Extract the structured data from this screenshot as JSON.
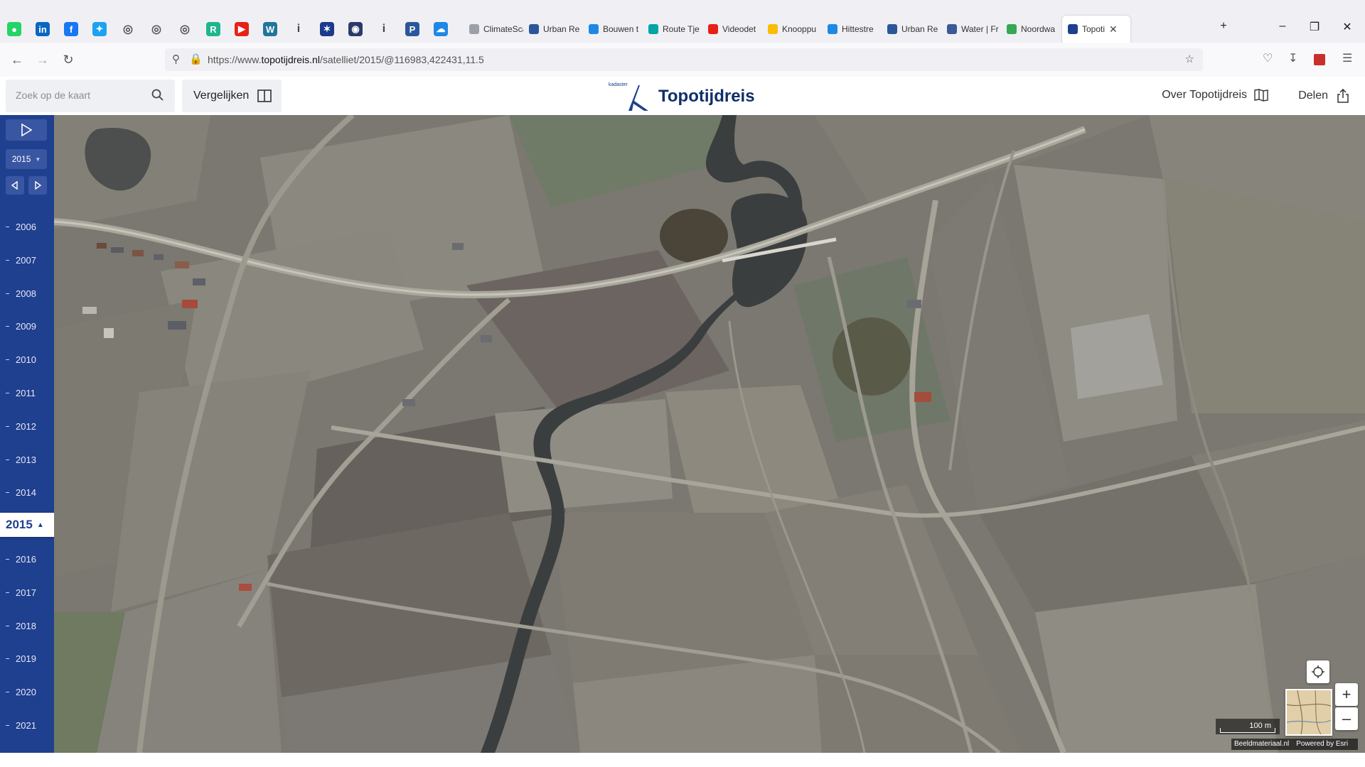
{
  "browser": {
    "pinned_icons": [
      "whatsapp-icon",
      "linkedin-icon",
      "facebook-icon",
      "twitter-icon",
      "globe-icon",
      "globe-icon",
      "globe-icon",
      "rg-icon",
      "youtube-icon",
      "wordpress-icon",
      "info-icon",
      "bluetooth-icon",
      "shield-icon",
      "info-icon",
      "parking-icon",
      "cloud-icon"
    ],
    "tabs": [
      {
        "label": "ClimateScan",
        "icon_color": "#9aa0a6"
      },
      {
        "label": "Urban Re",
        "icon_color": "#2b579a"
      },
      {
        "label": "Bouwen t",
        "icon_color": "#1e88e5"
      },
      {
        "label": "Route Tje",
        "icon_color": "#00a5a5"
      },
      {
        "label": "Videodet",
        "icon_color": "#e62117"
      },
      {
        "label": "Knooppu",
        "icon_color": "#fbbc05"
      },
      {
        "label": "Hittestre",
        "icon_color": "#1e88e5"
      },
      {
        "label": "Urban Re",
        "icon_color": "#2b579a"
      },
      {
        "label": "Water | Fr",
        "icon_color": "#3b5998"
      },
      {
        "label": "Noordwa",
        "icon_color": "#34a853"
      },
      {
        "label": "Topoti",
        "icon_color": "#1f3f8f"
      }
    ],
    "url_prefix": "https://www.",
    "url_domain": "topotijdreis.nl",
    "url_path": "/satelliet/2015/@116983,422431,11.5"
  },
  "app": {
    "search_placeholder": "Zoek op de kaart",
    "compare_label": "Vergelijken",
    "logo_small": "kadaster",
    "title": "Topotijdreis",
    "about_label": "Over Topotijdreis",
    "share_label": "Delen"
  },
  "timeline": {
    "selected_year_dropdown": "2015",
    "years": [
      "2006",
      "2007",
      "2008",
      "2009",
      "2010",
      "2011",
      "2012",
      "2013",
      "2014",
      "2015",
      "2016",
      "2017",
      "2018",
      "2019",
      "2020",
      "2021"
    ],
    "current_year": "2015",
    "accent": "#1f3f8f"
  },
  "map": {
    "scale_label": "100 m",
    "attribution": [
      "Beeldmateriaal.nl",
      "Powered by Esri"
    ]
  }
}
